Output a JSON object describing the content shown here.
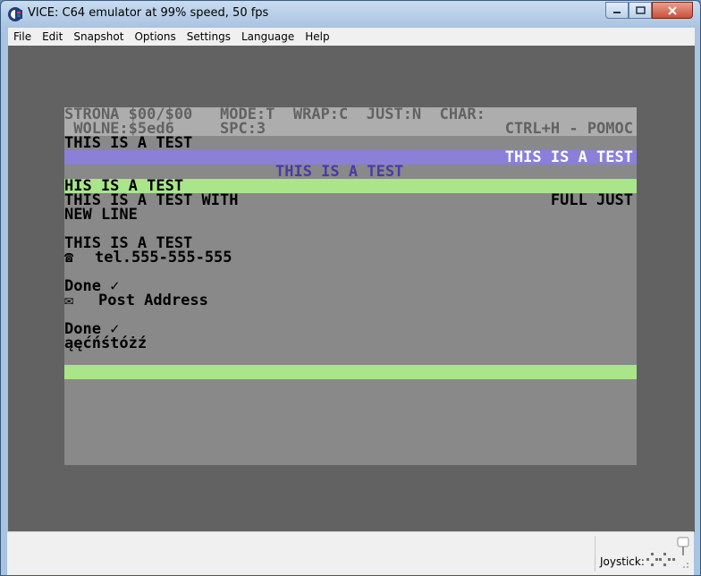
{
  "window": {
    "title": "VICE: C64 emulator at 99% speed, 50 fps"
  },
  "menu": {
    "items": [
      "File",
      "Edit",
      "Snapshot",
      "Options",
      "Settings",
      "Language",
      "Help"
    ]
  },
  "c64": {
    "colors": {
      "border": "#626262",
      "background": "#898989",
      "header": "#adadad",
      "purple": "#8a7fd9",
      "green": "#a9e68a",
      "header_text": "#626262",
      "purple_text": "#483aaa",
      "white": "#ffffff"
    },
    "header": {
      "line1": "STRONA $00/$00   MODE:T  WRAP:C  JUST:N  CHAR:",
      "line2_left": " WOLNE:$5ed6     SPC:3",
      "line2_right": "CTRL+H - POMOC"
    },
    "lines": {
      "l1": "THIS IS A TEST",
      "l2_right": "THIS IS A TEST",
      "l3_center": "THIS IS A TEST",
      "l4": "HIS IS A TEST",
      "l5_left": "THIS IS A TEST WITH",
      "l5_right": "FULL JUST",
      "l6": "NEW LINE",
      "l7": "THIS IS A TEST",
      "l8_icon": "☎",
      "l8": "tel.555-555-555",
      "l9": "Done ✓",
      "l10_icon": "✉",
      "l10": "Post Address",
      "l11": "Done ✓",
      "l12": "ąęćńśtóżź"
    }
  },
  "status": {
    "joystick_label": "Joystick:"
  }
}
